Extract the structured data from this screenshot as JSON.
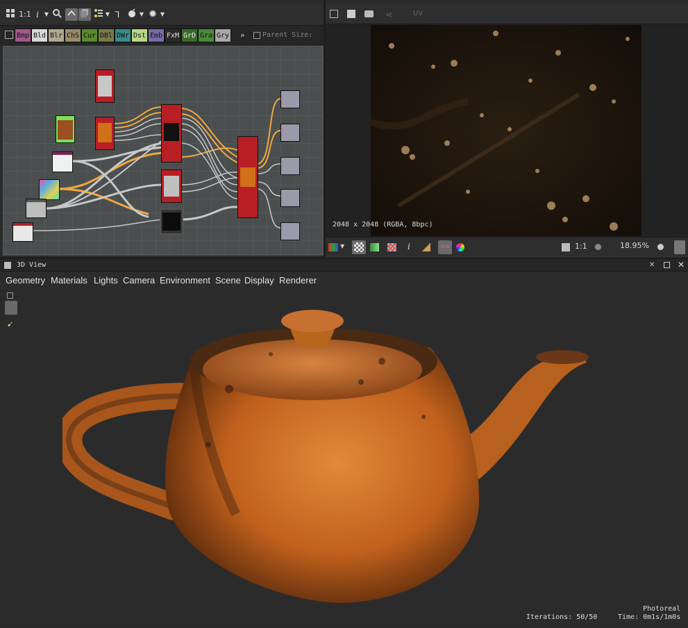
{
  "graph_toolbar": {
    "zoom_label": "1:1",
    "info_label": "i"
  },
  "filter_chips": [
    "Bmp",
    "Bld",
    "Blr",
    "ChS",
    "Cur",
    "DBl",
    "DWr",
    "Dst",
    "Emb",
    "FxM",
    "GrD",
    "Gra",
    "Gry"
  ],
  "filter_more": "»",
  "parent_size_label": "Parent Size:",
  "image_toolbar": {
    "uv_label": "UV"
  },
  "image_info": "2048 x 2048 (RGBA, 8bpc)",
  "image_bottom": {
    "ratio_label": "1:1",
    "zoom_value": "18.95%",
    "rgb_label": "RGB"
  },
  "view3d": {
    "title": "3D View",
    "menu": [
      "Geometry",
      "Materials",
      "Lights",
      "Camera",
      "Environment",
      "Scene",
      "Display",
      "Renderer"
    ],
    "status_mode": "Photoreal",
    "iterations": "Iterations: 50/50",
    "time": "Time: 0m1s/1m0s"
  },
  "colors": {
    "node_red": "#b81e24",
    "orange_wire": "#f0a840",
    "gray_wire": "#c8c8c8",
    "teapot_orange": "#c8641e"
  }
}
